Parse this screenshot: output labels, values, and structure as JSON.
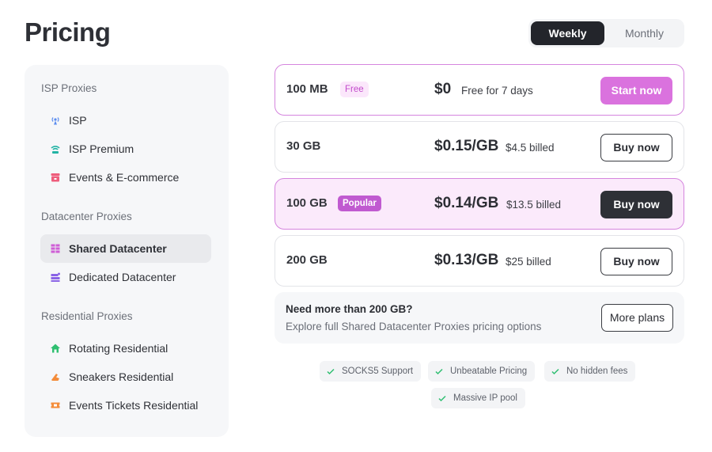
{
  "page": {
    "title": "Pricing"
  },
  "billing_toggle": {
    "weekly": "Weekly",
    "monthly": "Monthly",
    "selected": "Weekly"
  },
  "sidebar": {
    "sections": [
      {
        "title": "ISP Proxies",
        "items": [
          {
            "label": "ISP",
            "icon": "antenna-icon",
            "color": "#5b8def"
          },
          {
            "label": "ISP Premium",
            "icon": "wifi-icon",
            "color": "#22b3a4"
          },
          {
            "label": "Events & E-commerce",
            "icon": "shop-icon",
            "color": "#ee5d7c"
          }
        ]
      },
      {
        "title": "Datacenter Proxies",
        "items": [
          {
            "label": "Shared Datacenter",
            "icon": "grid-icon",
            "color": "#cf5fd6",
            "active": true
          },
          {
            "label": "Dedicated Datacenter",
            "icon": "server-icon",
            "color": "#8a63e6"
          }
        ]
      },
      {
        "title": "Residential Proxies",
        "items": [
          {
            "label": "Rotating Residential",
            "icon": "home-icon",
            "color": "#2fbf71"
          },
          {
            "label": "Sneakers Residential",
            "icon": "sneaker-icon",
            "color": "#f48c3a"
          },
          {
            "label": "Events Tickets Residential",
            "icon": "ticket-icon",
            "color": "#f48c3a"
          }
        ]
      }
    ]
  },
  "plans": [
    {
      "size": "100 MB",
      "badge": "Free",
      "price": "$0",
      "billed": "Free for 7 days",
      "button": "Start now"
    },
    {
      "size": "30 GB",
      "badge": "",
      "price": "$0.15/GB",
      "billed": "$4.5 billed",
      "button": "Buy now"
    },
    {
      "size": "100 GB",
      "badge": "Popular",
      "price": "$0.14/GB",
      "billed": "$13.5 billed",
      "button": "Buy now"
    },
    {
      "size": "200 GB",
      "badge": "",
      "price": "$0.13/GB",
      "billed": "$25 billed",
      "button": "Buy now"
    }
  ],
  "more": {
    "question": "Need more than 200 GB?",
    "description": "Explore full Shared Datacenter Proxies pricing options",
    "button": "More plans"
  },
  "features": [
    "SOCKS5 Support",
    "Unbeatable Pricing",
    "No hidden fees",
    "Massive IP pool"
  ],
  "colors": {
    "accent": "#da72de",
    "dark": "#2e3036",
    "check": "#2fbf71"
  }
}
